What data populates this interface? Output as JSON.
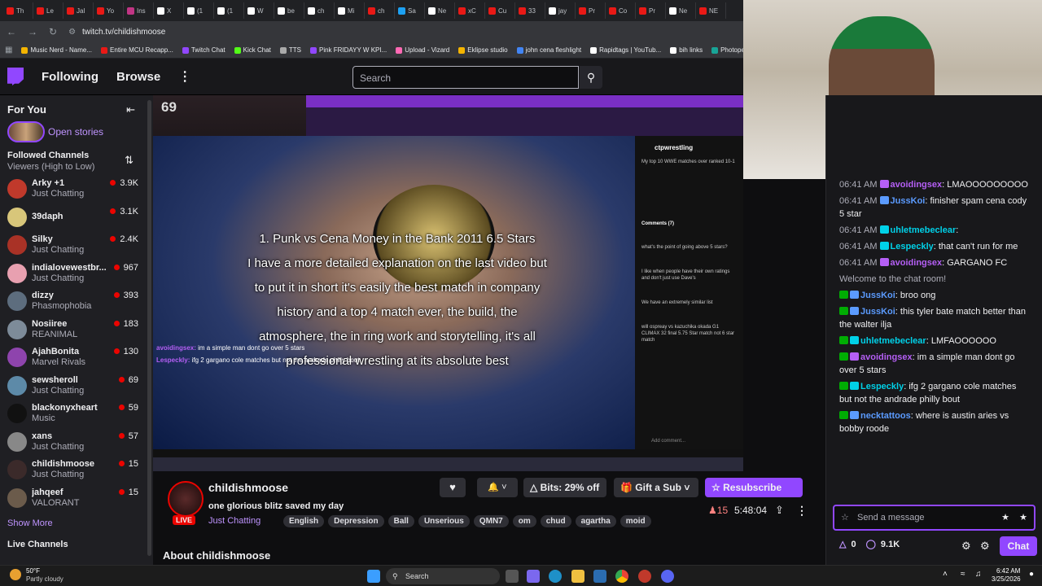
{
  "browser": {
    "tabs": [
      {
        "label": "Th",
        "color": "#e91916"
      },
      {
        "label": "Le",
        "color": "#e91916"
      },
      {
        "label": "Jal",
        "color": "#e91916"
      },
      {
        "label": "Yo",
        "color": "#e91916"
      },
      {
        "label": "Ins",
        "color": "#c13584"
      },
      {
        "label": "X",
        "color": "#ffffff"
      },
      {
        "label": "(1",
        "color": "#ffffff"
      },
      {
        "label": "(1",
        "color": "#ffffff"
      },
      {
        "label": "W",
        "color": "#ffffff"
      },
      {
        "label": "be",
        "color": "#ffffff"
      },
      {
        "label": "ch",
        "color": "#ffffff"
      },
      {
        "label": "Mi",
        "color": "#ffffff"
      },
      {
        "label": "ch",
        "color": "#e91916"
      },
      {
        "label": "Sa",
        "color": "#1da1f2"
      },
      {
        "label": "Ne",
        "color": "#ffffff"
      },
      {
        "label": "xC",
        "color": "#e91916"
      },
      {
        "label": "Cu",
        "color": "#e91916"
      },
      {
        "label": "33",
        "color": "#e91916"
      },
      {
        "label": "jay",
        "color": "#ffffff"
      },
      {
        "label": "Pr",
        "color": "#e91916"
      },
      {
        "label": "Co",
        "color": "#e91916"
      },
      {
        "label": "Pr",
        "color": "#e91916"
      },
      {
        "label": "Ne",
        "color": "#ffffff"
      },
      {
        "label": "NE",
        "color": "#e91916"
      }
    ],
    "url": "twitch.tv/childishmoose",
    "bookmarks": [
      {
        "label": "Music Nerd - Name...",
        "color": "#f4b400"
      },
      {
        "label": "Entire MCU Recapp...",
        "color": "#e91916"
      },
      {
        "label": "Twitch Chat",
        "color": "#9147ff"
      },
      {
        "label": "Kick Chat",
        "color": "#53fc18"
      },
      {
        "label": "TTS",
        "color": "#aaaaaa"
      },
      {
        "label": "Pink FRIDAYY W KPI...",
        "color": "#9147ff"
      },
      {
        "label": "Upload - Vizard",
        "color": "#ff69b4"
      },
      {
        "label": "Eklipse studio",
        "color": "#f4b400"
      },
      {
        "label": "john cena fleshlight",
        "color": "#4285f4"
      },
      {
        "label": "Rapidtags | YouTub...",
        "color": "#ffffff"
      },
      {
        "label": "bih links",
        "color": "#ffffff"
      },
      {
        "label": "Photopea",
        "color": "#18a497"
      }
    ]
  },
  "nav": {
    "following": "Following",
    "browse": "Browse",
    "search_placeholder": "Search"
  },
  "sidebar": {
    "for_you": "For You",
    "open_stories": "Open stories",
    "followed_title": "Followed Channels",
    "sort_label": "Viewers (High to Low)",
    "channels": [
      {
        "name": "Arky +1",
        "category": "Just Chatting",
        "viewers": "3.9K",
        "color": "#c0392b"
      },
      {
        "name": "39daph",
        "category": "",
        "viewers": "3.1K",
        "color": "#d8c67a"
      },
      {
        "name": "Silky",
        "category": "Just Chatting",
        "viewers": "2.4K",
        "color": "#a93226"
      },
      {
        "name": "indialovewestbr...",
        "category": "Just Chatting",
        "viewers": "967",
        "color": "#e8a0b0"
      },
      {
        "name": "dizzy",
        "category": "Phasmophobia",
        "viewers": "393",
        "color": "#5d6d7e"
      },
      {
        "name": "Nosiiree",
        "category": "REANIMAL",
        "viewers": "183",
        "color": "#7d8b99"
      },
      {
        "name": "AjahBonita",
        "category": "Marvel Rivals",
        "viewers": "130",
        "color": "#8e44ad"
      },
      {
        "name": "sewsheroll",
        "category": "Just Chatting",
        "viewers": "69",
        "color": "#5d8aa8"
      },
      {
        "name": "blackonyxheart",
        "category": "Music",
        "viewers": "59",
        "color": "#111111"
      },
      {
        "name": "xans",
        "category": "Just Chatting",
        "viewers": "57",
        "color": "#888888"
      },
      {
        "name": "childishmoose",
        "category": "Just Chatting",
        "viewers": "15",
        "color": "#3b2a2a"
      },
      {
        "name": "jahqeef",
        "category": "VALORANT",
        "viewers": "15",
        "color": "#6b5b4b"
      }
    ],
    "show_more": "Show More",
    "live_channels": "Live Channels"
  },
  "video": {
    "counter": "69",
    "overlay_lines": [
      "1. Punk vs Cena Money in the Bank 2011 6.5 Stars",
      "I have a more detailed explanation on the last video but",
      "to put it in short it's easily the best match in company",
      "history and a top 4 match ever, the build, the",
      "atmosphere, the in ring work and storytelling, it's all",
      "professional wrestling at its absolute best"
    ],
    "inner_chat": [
      {
        "name": "avoidingsex:",
        "text": "im a simple man dont go over 5 stars"
      },
      {
        "name": "Lespeckly:",
        "text": "ifg 2 gargano cole matches but not the andrade philly bout"
      }
    ],
    "post_user": "ctpwrestling",
    "post_caption": "My top 10 WWE matches over ranked 10-1",
    "comments_label": "Comments (7)",
    "comments": [
      "what's the point of going above 5 stars?",
      "I like when people have their own ratings and don't just use Dave's",
      "We have an extremely similar list",
      "will ospreay vs kazuchika okada G1 CLIMAX 32 final 5.75 Star match not 6 star match"
    ],
    "add_comment": "Add comment..."
  },
  "stream": {
    "streamer": "childishmoose",
    "title": "one glorious blitz saved my day",
    "live_badge": "LIVE",
    "category": "Just Chatting",
    "tags": [
      "English",
      "Depression",
      "Ball",
      "Unserious",
      "QMN7",
      "om",
      "chud",
      "agartha",
      "moid"
    ],
    "viewers": "15",
    "uptime": "5:48:04",
    "bits_label": "Bits: 29% off",
    "gift_label": "Gift a Sub",
    "resub_label": "Resubscribe",
    "about": "About childishmoose"
  },
  "chat": {
    "messages": [
      {
        "time": "06:41 AM",
        "user": "avoidingsex",
        "color": "#b55ff5",
        "text": "LMAOOOOOOOOO"
      },
      {
        "time": "06:41 AM",
        "user": "JussKoi",
        "color": "#5b9bff",
        "text": "finisher spam cena cody 5 star"
      },
      {
        "time": "06:41 AM",
        "user": "uhletmebeclear",
        "color": "#00d1e8",
        "text": ""
      },
      {
        "time": "06:41 AM",
        "user": "Lespeckly",
        "color": "#00d1e8",
        "text": "that can't run for me"
      },
      {
        "time": "06:41 AM",
        "user": "avoidingsex",
        "color": "#b55ff5",
        "text": "GARGANO FC"
      },
      {
        "time": "",
        "user": "",
        "color": "#adadb8",
        "text": "Welcome to the chat room!"
      },
      {
        "time": "",
        "user": "JussKoi",
        "color": "#5b9bff",
        "text": "broo ong"
      },
      {
        "time": "",
        "user": "JussKoi",
        "color": "#5b9bff",
        "text": "this tyler bate match better than the walter ilja"
      },
      {
        "time": "",
        "user": "uhletmebeclear",
        "color": "#00d1e8",
        "text": "LMFAOOOOOO"
      },
      {
        "time": "",
        "user": "avoidingsex",
        "color": "#b55ff5",
        "text": "im a simple man dont go over 5 stars"
      },
      {
        "time": "",
        "user": "Lespeckly",
        "color": "#00d1e8",
        "text": "ifg 2 gargano cole matches but not the andrade philly bout"
      },
      {
        "time": "",
        "user": "necktattoos",
        "color": "#5b9bff",
        "text": "where is austin aries vs bobby roode"
      }
    ],
    "input_placeholder": "Send a message",
    "points": "0",
    "bits_count": "9.1K",
    "chat_button": "Chat"
  },
  "taskbar": {
    "temp": "50°F",
    "weather": "Partly cloudy",
    "search": "Search",
    "time": "6:42 AM",
    "date": "3/25/2026"
  }
}
